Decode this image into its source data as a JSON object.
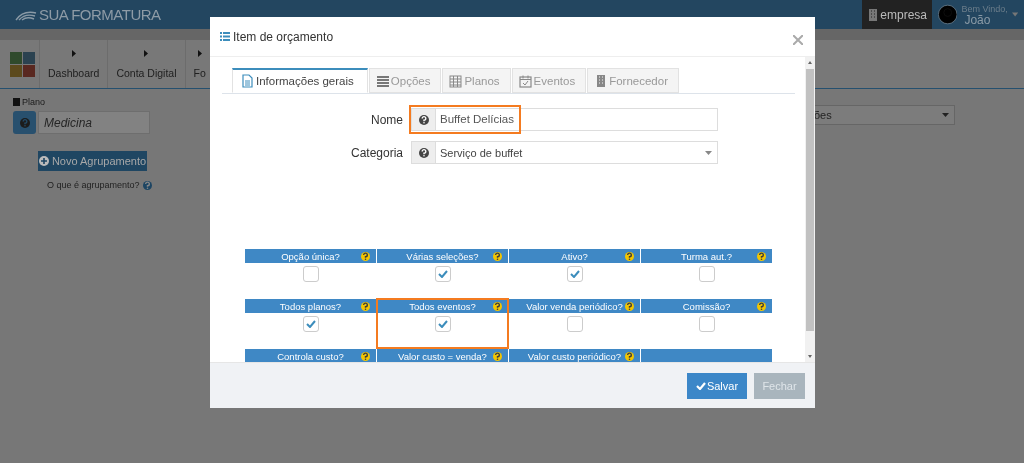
{
  "background": {
    "logo": "SUA FORMATURA",
    "company_button": "empresa",
    "user": {
      "greeting": "Bem Vindo,",
      "name": "João"
    },
    "nav": [
      {
        "label": "Dashboard"
      },
      {
        "label": "Conta Digital"
      },
      {
        "label": "Fo"
      }
    ],
    "plano": {
      "label": "Plano",
      "value": "Medicina"
    },
    "new_group_button": "Novo Agrupamento",
    "help_link": "O que é agrupamento?",
    "select_value": "ões"
  },
  "modal": {
    "title": "Item de orçamento",
    "tabs": [
      {
        "label": "Informações gerais",
        "selected": true
      },
      {
        "label": "Opções",
        "selected": false
      },
      {
        "label": "Planos",
        "selected": false
      },
      {
        "label": "Eventos",
        "selected": false
      },
      {
        "label": "Fornecedor",
        "selected": false
      }
    ],
    "fields": [
      {
        "kind": "text",
        "label": "Nome",
        "value": "Buffet Delícias",
        "highlighted": true
      },
      {
        "kind": "select",
        "label": "Categoria",
        "value": "Serviço de buffet",
        "highlighted": false
      }
    ],
    "options": [
      {
        "label": "Opção única?",
        "checked": false,
        "highlighted": false
      },
      {
        "label": "Várias seleções?",
        "checked": true,
        "highlighted": false
      },
      {
        "label": "Ativo?",
        "checked": true,
        "highlighted": false
      },
      {
        "label": "Turma aut.?",
        "checked": false,
        "highlighted": false
      },
      {
        "label": "Todos planos?",
        "checked": true,
        "highlighted": false
      },
      {
        "label": "Todos eventos?",
        "checked": true,
        "highlighted": true
      },
      {
        "label": "Valor venda periódico?",
        "checked": false,
        "highlighted": false
      },
      {
        "label": "Comissão?",
        "checked": false,
        "highlighted": false
      }
    ],
    "partial_options": [
      {
        "label": "Controla custo?"
      },
      {
        "label": "Valor custo = venda?"
      },
      {
        "label": "Valor custo periódico?"
      }
    ],
    "buttons": [
      {
        "label": "Salvar",
        "disabled": false
      },
      {
        "label": "Fechar",
        "disabled": true
      }
    ]
  }
}
